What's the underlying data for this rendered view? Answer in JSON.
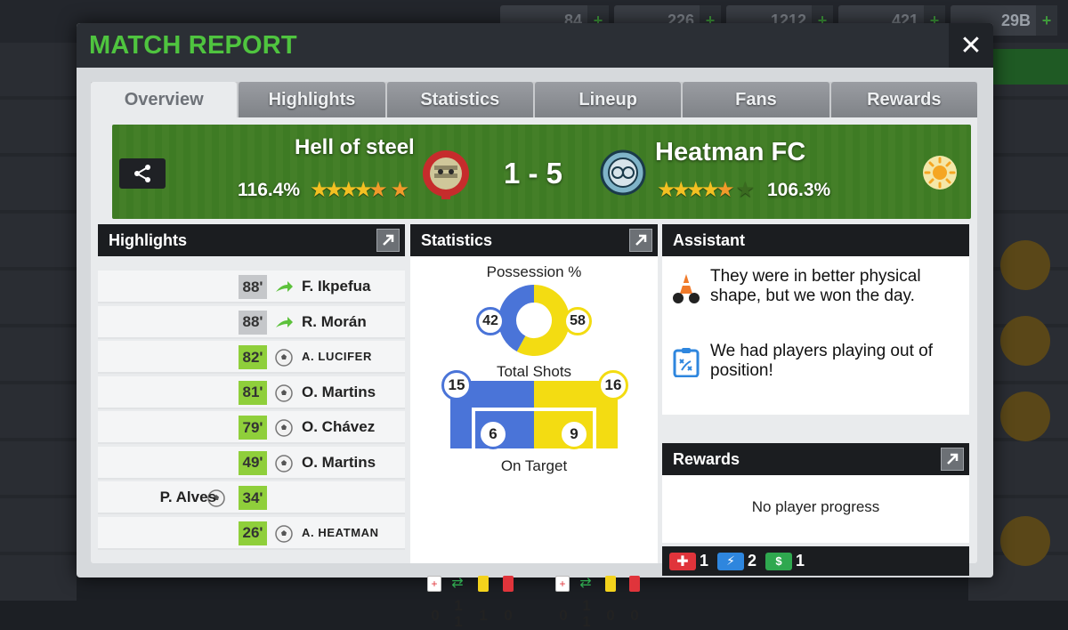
{
  "background": {
    "resources": [
      {
        "value": "84",
        "icon": "helmet-icon"
      },
      {
        "value": "226",
        "icon": "cash-icon"
      },
      {
        "value": "1212",
        "icon": "energy-icon"
      },
      {
        "value": "421",
        "icon": "medkit-icon"
      },
      {
        "value": "29B",
        "icon": "money-icon"
      }
    ]
  },
  "modal": {
    "title": "MATCH REPORT",
    "close_label": "✕"
  },
  "tabs": [
    {
      "label": "Overview",
      "active": true
    },
    {
      "label": "Highlights",
      "active": false
    },
    {
      "label": "Statistics",
      "active": false
    },
    {
      "label": "Lineup",
      "active": false
    },
    {
      "label": "Fans",
      "active": false
    },
    {
      "label": "Rewards",
      "active": false
    }
  ],
  "match": {
    "home": {
      "name": "Hell of steel",
      "rating": "116.4%",
      "stars": 5.5
    },
    "away": {
      "name": "Heatman FC",
      "rating": "106.3%",
      "stars": 5
    },
    "score": "1 - 5",
    "weather_icon": "sun-icon"
  },
  "highlights": {
    "title": "Highlights",
    "rows": [
      {
        "minute": "88'",
        "name": "F. Ikpefua",
        "side": "away",
        "type": "substitution",
        "caps": false
      },
      {
        "minute": "88'",
        "name": "R. Morán",
        "side": "away",
        "type": "substitution",
        "caps": false
      },
      {
        "minute": "82'",
        "name": "A. LUCIFER",
        "side": "away",
        "type": "goal",
        "caps": true
      },
      {
        "minute": "81'",
        "name": "O. Martins",
        "side": "away",
        "type": "goal",
        "caps": false
      },
      {
        "minute": "79'",
        "name": "O. Chávez",
        "side": "away",
        "type": "goal",
        "caps": false
      },
      {
        "minute": "49'",
        "name": "O. Martins",
        "side": "away",
        "type": "goal",
        "caps": false
      },
      {
        "minute": "34'",
        "name": "P. Alves",
        "side": "home",
        "type": "goal",
        "caps": false
      },
      {
        "minute": "26'",
        "name": "A. HEATMAN",
        "side": "away",
        "type": "goal",
        "caps": true
      }
    ]
  },
  "statistics": {
    "title": "Statistics",
    "possession_label": "Possession %",
    "possession": {
      "home": 42,
      "away": 58
    },
    "shots_label": "Total Shots",
    "shots": {
      "home": 15,
      "away": 16
    },
    "on_target_label": "On Target",
    "on_target": {
      "home": 6,
      "away": 9
    },
    "discipline": {
      "home": {
        "injuries": "0",
        "subs": "1\n1",
        "yellow": "1",
        "red": "0"
      },
      "away": {
        "injuries": "0",
        "subs": "1\n1",
        "yellow": "0",
        "red": "0"
      }
    },
    "colors": {
      "home": "#4a74d8",
      "away": "#f3dc12"
    }
  },
  "assistant": {
    "title": "Assistant",
    "messages": [
      {
        "icon": "training-cones-icon",
        "text": "They were in better physical shape, but we won the day."
      },
      {
        "icon": "tactics-clipboard-icon",
        "text": "We had players playing out of position!"
      }
    ]
  },
  "rewards": {
    "title": "Rewards",
    "message": "No player progress",
    "items": [
      {
        "icon": "medkit-icon",
        "count": "1",
        "color": "#e0343b"
      },
      {
        "icon": "energy-icon",
        "count": "2",
        "color": "#2e86de"
      },
      {
        "icon": "cash-icon",
        "count": "1",
        "color": "#2fa84f"
      }
    ]
  }
}
